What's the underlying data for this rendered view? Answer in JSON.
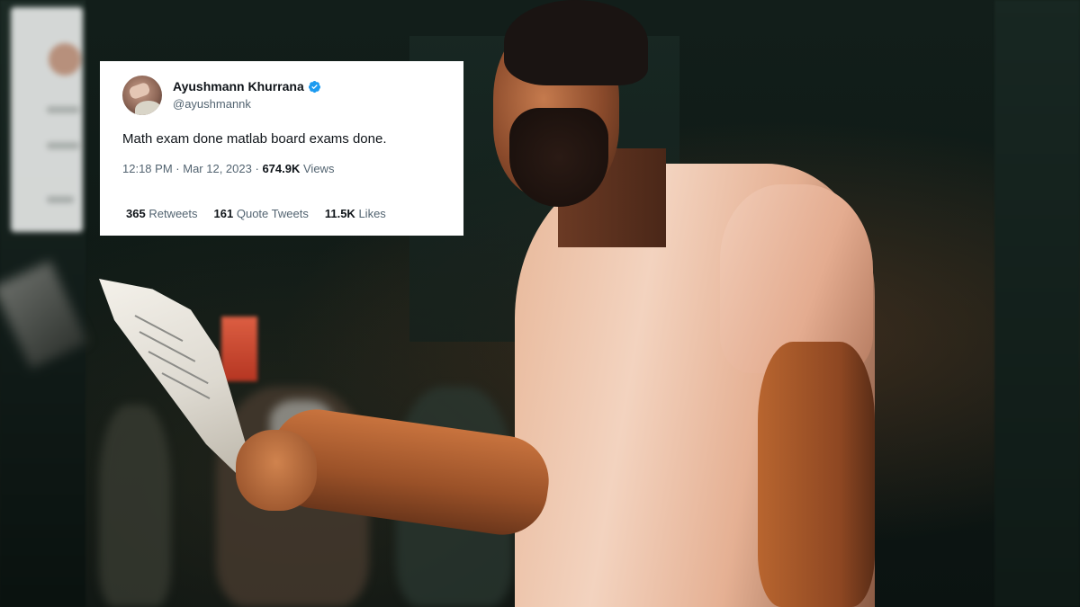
{
  "tweet": {
    "author_name": "Ayushmann Khurrana",
    "author_handle": "@ayushmannk",
    "verified": true,
    "text": "Math exam done matlab board exams done.",
    "time": "12:18 PM",
    "separator": "·",
    "date": "Mar 12, 2023",
    "views_count": "674.9K",
    "views_label": "Views",
    "retweets_count": "365",
    "retweets_label": "Retweets",
    "quotes_count": "161",
    "quotes_label": "Quote Tweets",
    "likes_count": "11.5K",
    "likes_label": "Likes"
  },
  "colors": {
    "verified_badge": "#1d9bf0",
    "text_primary": "#0f1419",
    "text_secondary": "#536471",
    "card_background": "#ffffff"
  },
  "icons": {
    "verified": "verified-badge-icon"
  }
}
